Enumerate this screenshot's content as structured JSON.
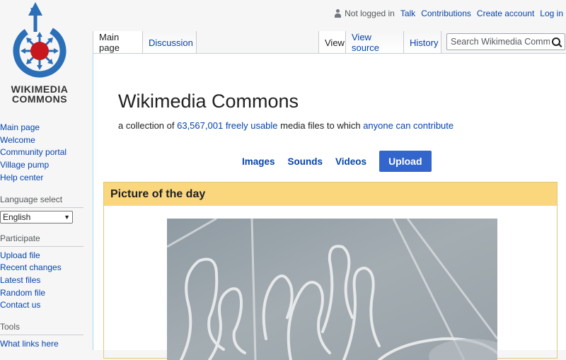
{
  "personal": {
    "status": "Not logged in",
    "links": [
      "Talk",
      "Contributions",
      "Create account",
      "Log in"
    ]
  },
  "logo": {
    "line1": "WIKIMEDIA",
    "line2": "COMMONS"
  },
  "sidebar": {
    "nav": [
      "Main page",
      "Welcome",
      "Community portal",
      "Village pump",
      "Help center"
    ],
    "language_heading": "Language select",
    "language_value": "English",
    "participate_heading": "Participate",
    "participate": [
      "Upload file",
      "Recent changes",
      "Latest files",
      "Random file",
      "Contact us"
    ],
    "tools_heading": "Tools",
    "tools": [
      "What links here"
    ]
  },
  "tabs": {
    "main_page": "Main page",
    "discussion": "Discussion",
    "view": "View",
    "view_source": "View source",
    "history": "History"
  },
  "search": {
    "placeholder": "Search Wikimedia Commons"
  },
  "main": {
    "title": "Wikimedia Commons",
    "subtitle_prefix": "a collection of ",
    "file_count": "63,567,001",
    "freely_usable": "freely usable",
    "subtitle_mid": " media files to which ",
    "anyone_contribute": "anyone can contribute",
    "media_links": [
      "Images",
      "Sounds",
      "Videos"
    ],
    "upload_label": "Upload",
    "potd_heading": "Picture of the day"
  },
  "colors": {
    "link": "#0645ad",
    "upload_button": "#3366cc",
    "potd_header": "#fad67d",
    "potd_border": "#e2c87a",
    "logo_blue": "#2a6fb8",
    "logo_red": "#c8181e"
  },
  "icons": [
    "user-icon",
    "search-icon",
    "commons-logo-icon",
    "chevron-down-icon"
  ]
}
